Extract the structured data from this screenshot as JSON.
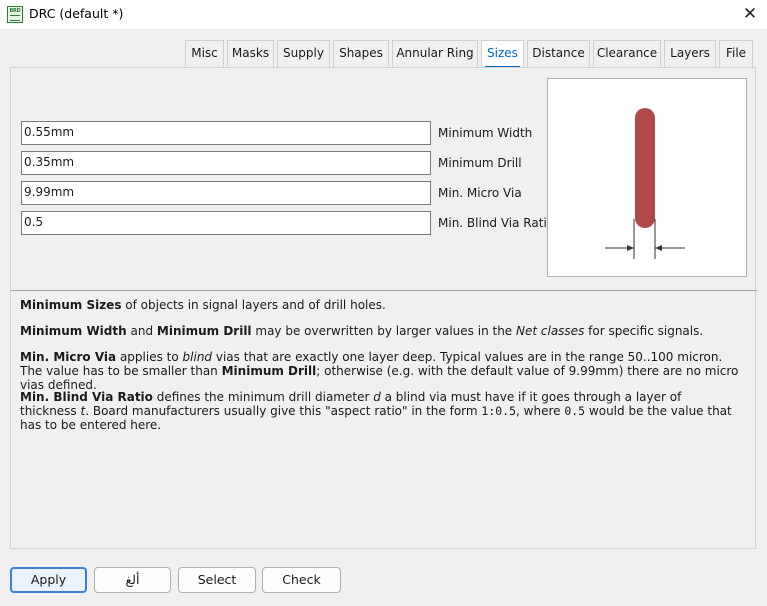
{
  "window": {
    "title": "DRC (default *)",
    "icon_text": "BRD",
    "close_glyph": "✕"
  },
  "tabs": [
    {
      "label": "Misc",
      "active": false
    },
    {
      "label": "Masks",
      "active": false
    },
    {
      "label": "Supply",
      "active": false
    },
    {
      "label": "Shapes",
      "active": false
    },
    {
      "label": "Annular Ring",
      "active": false
    },
    {
      "label": "Sizes",
      "active": true
    },
    {
      "label": "Distance",
      "active": false
    },
    {
      "label": "Clearance",
      "active": false
    },
    {
      "label": "Layers",
      "active": false
    },
    {
      "label": "File",
      "active": false
    }
  ],
  "fields": {
    "min_width": {
      "value": " 0.55mm",
      "label": "Minimum Width"
    },
    "min_drill": {
      "value": "0.35mm",
      "label": "Minimum Drill"
    },
    "min_micro_via": {
      "value": "9.99mm",
      "label": "Min. Micro Via"
    },
    "min_blind_via_ratio": {
      "value": "0.5",
      "label": "Min. Blind Via Ratio"
    }
  },
  "help": {
    "p1": {
      "b1": "Minimum Sizes",
      "t1": " of objects in signal layers and of drill holes."
    },
    "p2": {
      "b1": "Minimum Width",
      "t1": " and ",
      "b2": "Minimum Drill",
      "t2": " may be overwritten by larger values in the ",
      "i1": "Net classes",
      "t3": " for specific signals."
    },
    "p3": {
      "b1": "Min. Micro Via",
      "t1": " applies to ",
      "i1": "blind",
      "t2": " vias that are exactly one layer deep. Typical values are in the range 50..100 micron. The value has to be smaller than ",
      "b2": "Minimum Drill",
      "t3": "; otherwise (e.g. with the default value of 9.99mm) there are no micro vias defined."
    },
    "p4": {
      "b1": "Min. Blind Via Ratio",
      "t1": " defines the minimum drill diameter ",
      "i1": "d",
      "t2": " a blind via must have if it goes through a layer of thickness ",
      "i2": "t",
      "t3": ". Board manufacturers usually give this \"aspect ratio\" in the form ",
      "m1": "1:0.5",
      "t4": ", where ",
      "m2": "0.5",
      "t5": " would be the value that has to be entered here."
    }
  },
  "buttons": {
    "apply": "Apply",
    "cancel": "ألغ",
    "select": "Select",
    "check": "Check"
  },
  "colors": {
    "accent": "#0067c0",
    "trace": "#b04a4a"
  }
}
